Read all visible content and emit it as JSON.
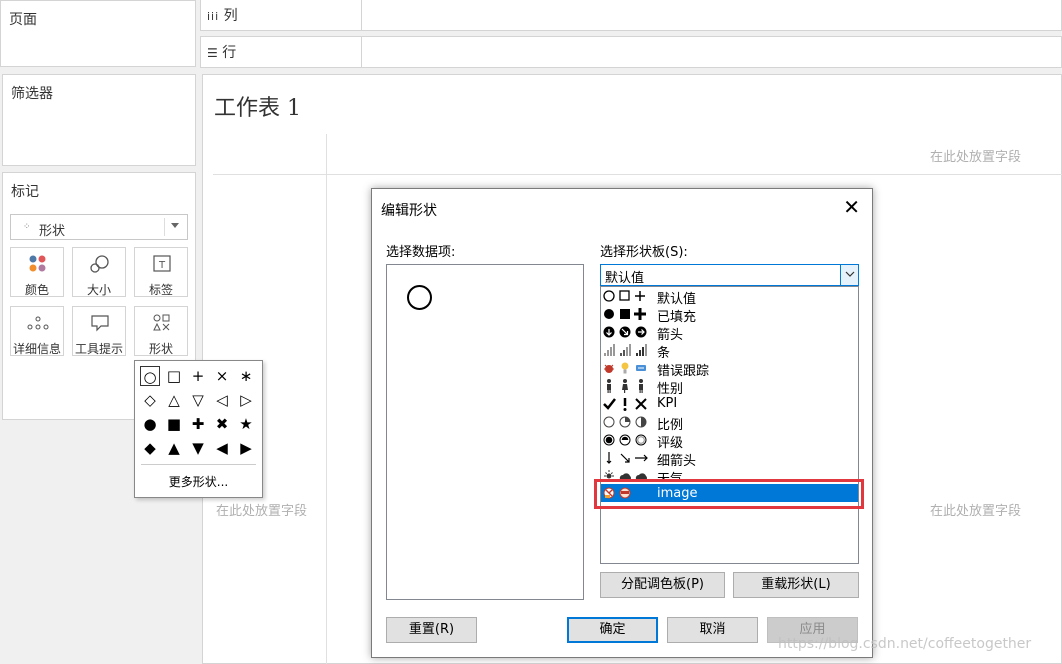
{
  "panes": {
    "pages_title": "页面",
    "filters_title": "筛选器",
    "marks_title": "标记"
  },
  "shelves": {
    "columns_label": "列",
    "rows_label": "行",
    "columns_icon": "columns-icon",
    "rows_icon": "rows-icon"
  },
  "marks": {
    "mark_type": "形状",
    "mark_type_icon": "shape-type-icon",
    "buttons": [
      {
        "label": "颜色",
        "icon": "color-icon"
      },
      {
        "label": "大小",
        "icon": "size-icon"
      },
      {
        "label": "标签",
        "icon": "label-icon"
      },
      {
        "label": "详细信息",
        "icon": "detail-icon"
      },
      {
        "label": "工具提示",
        "icon": "tooltip-icon"
      },
      {
        "label": "形状",
        "icon": "shape-icon"
      }
    ]
  },
  "shape_popup": {
    "shapes": [
      "○",
      "□",
      "+",
      "×",
      "∗",
      "◇",
      "△",
      "▽",
      "◁",
      "▷",
      "●",
      "■",
      "✚",
      "✖",
      "★",
      "◆",
      "▲",
      "▼",
      "◀",
      "▶"
    ],
    "more_label": "更多形状..."
  },
  "worksheet": {
    "title": "工作表 1",
    "drop_hint_top": "在此处放置字段",
    "drop_hint_left": "在此处放置字段",
    "drop_hint_right": "在此处放置字段"
  },
  "dialog": {
    "title": "编辑形状",
    "data_items_label": "选择数据项:",
    "palette_label": "选择形状板(S):",
    "selected_palette": "默认值",
    "palettes": [
      {
        "label": "默认值"
      },
      {
        "label": "已填充"
      },
      {
        "label": "箭头"
      },
      {
        "label": "条"
      },
      {
        "label": "错误跟踪"
      },
      {
        "label": "性别"
      },
      {
        "label": "KPI"
      },
      {
        "label": "比例"
      },
      {
        "label": "评级"
      },
      {
        "label": "细箭头"
      },
      {
        "label": "天气"
      },
      {
        "label": "image"
      }
    ],
    "selected_index": 11,
    "assign_button": "分配调色板(P)",
    "reload_button": "重载形状(L)",
    "reset_button": "重置(R)",
    "ok_button": "确定",
    "cancel_button": "取消",
    "apply_button": "应用",
    "highlight_color": "#e0383e",
    "selection_color": "#0078d7"
  },
  "watermark": "https://blog.csdn.net/coffeetogether"
}
